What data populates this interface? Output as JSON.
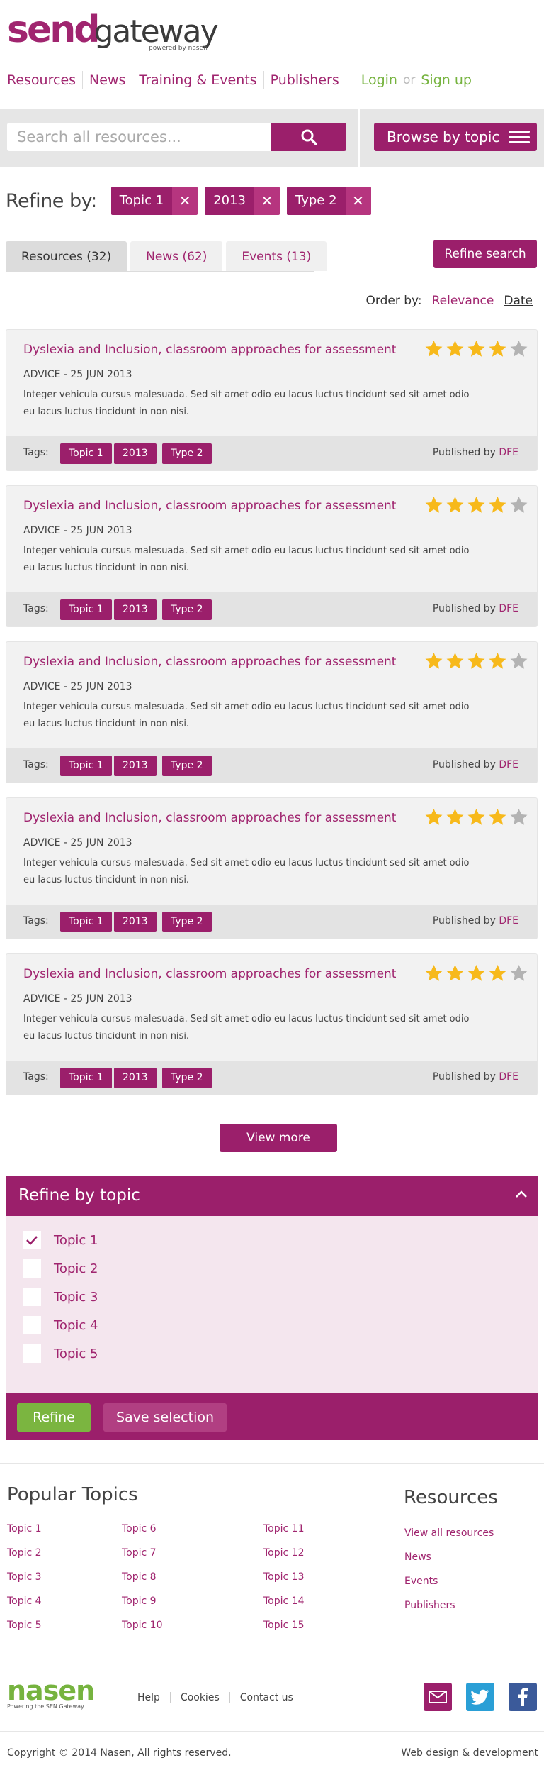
{
  "logo": {
    "send": "send",
    "gateway": "gateway",
    "powered": "powered by nasen"
  },
  "nav": {
    "links": [
      "Resources",
      "News",
      "Training & Events",
      "Publishers"
    ],
    "login": "Login",
    "or": "or",
    "signup": "Sign up"
  },
  "search": {
    "placeholder": "Search all resources...",
    "browse_label": "Browse by topic"
  },
  "refine": {
    "label": "Refine by:",
    "chips": [
      "Topic 1",
      "2013",
      "Type 2"
    ],
    "remove_glyph": "✕"
  },
  "tabs": [
    "Resources (32)",
    "News (62)",
    "Events (13)"
  ],
  "refine_search_label": "Refine search",
  "order": {
    "label": "Order by:",
    "relevance": "Relevance",
    "date": "Date"
  },
  "results": [
    {
      "title": "Dyslexia and Inclusion, classroom approaches for assessment",
      "meta": "ADVICE - 25 JUN 2013",
      "desc": "Integer vehicula cursus malesuada. Sed sit amet odio eu lacus luctus tincidunt sed sit amet odio eu lacus luctus tincidunt in non nisi.",
      "tags_label": "Tags:",
      "tags": [
        "Topic 1",
        "2013",
        "Type 2"
      ],
      "published_prefix": "Published by",
      "publisher": "DFE",
      "rating": 4
    },
    {
      "title": "Dyslexia and Inclusion, classroom approaches for assessment",
      "meta": "ADVICE - 25 JUN 2013",
      "desc": "Integer vehicula cursus malesuada. Sed sit amet odio eu lacus luctus tincidunt sed sit amet odio eu lacus luctus tincidunt in non nisi.",
      "tags_label": "Tags:",
      "tags": [
        "Topic 1",
        "2013",
        "Type 2"
      ],
      "published_prefix": "Published by",
      "publisher": "DFE",
      "rating": 4
    },
    {
      "title": "Dyslexia and Inclusion, classroom approaches for assessment",
      "meta": "ADVICE - 25 JUN 2013",
      "desc": "Integer vehicula cursus malesuada. Sed sit amet odio eu lacus luctus tincidunt sed sit amet odio eu lacus luctus tincidunt in non nisi.",
      "tags_label": "Tags:",
      "tags": [
        "Topic 1",
        "2013",
        "Type 2"
      ],
      "published_prefix": "Published by",
      "publisher": "DFE",
      "rating": 4
    },
    {
      "title": "Dyslexia and Inclusion, classroom approaches for assessment",
      "meta": "ADVICE - 25 JUN 2013",
      "desc": "Integer vehicula cursus malesuada. Sed sit amet odio eu lacus luctus tincidunt sed sit amet odio eu lacus luctus tincidunt in non nisi.",
      "tags_label": "Tags:",
      "tags": [
        "Topic 1",
        "2013",
        "Type 2"
      ],
      "published_prefix": "Published by",
      "publisher": "DFE",
      "rating": 4
    },
    {
      "title": "Dyslexia and Inclusion, classroom approaches for assessment",
      "meta": "ADVICE - 25 JUN 2013",
      "desc": "Integer vehicula cursus malesuada. Sed sit amet odio eu lacus luctus tincidunt sed sit amet odio eu lacus luctus tincidunt in non nisi.",
      "tags_label": "Tags:",
      "tags": [
        "Topic 1",
        "2013",
        "Type 2"
      ],
      "published_prefix": "Published by",
      "publisher": "DFE",
      "rating": 4
    }
  ],
  "view_more_label": "View more",
  "topic_panel": {
    "title": "Refine by topic",
    "topics": [
      {
        "label": "Topic 1",
        "checked": true
      },
      {
        "label": "Topic 2",
        "checked": false
      },
      {
        "label": "Topic 3",
        "checked": false
      },
      {
        "label": "Topic 4",
        "checked": false
      },
      {
        "label": "Topic 5",
        "checked": false
      }
    ],
    "refine_label": "Refine",
    "save_label": "Save selection"
  },
  "popular": {
    "title": "Popular Topics",
    "col1": [
      "Topic 1",
      "Topic 2",
      "Topic 3",
      "Topic 4",
      "Topic 5"
    ],
    "col2": [
      "Topic 6",
      "Topic 7",
      "Topic 8",
      "Topic 9",
      "Topic 10"
    ],
    "col3": [
      "Topic 11",
      "Topic 12",
      "Topic 13",
      "Topic 14",
      "Topic 15"
    ]
  },
  "resources_links": {
    "title": "Resources",
    "items": [
      "View all resources",
      "News",
      "Events",
      "Publishers"
    ]
  },
  "footer": {
    "logo": "nasen",
    "logo_sub": "Powering the SEN Gateway",
    "links": [
      "Help",
      "Cookies",
      "Contact us"
    ],
    "social": [
      {
        "name": "email-icon",
        "color": "#9b1f6b"
      },
      {
        "name": "twitter-icon",
        "color": "#2a9fd6"
      },
      {
        "name": "facebook-icon",
        "color": "#3b5a9a"
      }
    ],
    "copyright": "Copyright © 2014 Nasen, All rights reserved.",
    "credit": "Web design & development"
  },
  "colors": {
    "brand": "#9b1f6b",
    "accent_green": "#76b33f",
    "star": "#f7b91b",
    "star_empty": "#b3b3b3"
  }
}
